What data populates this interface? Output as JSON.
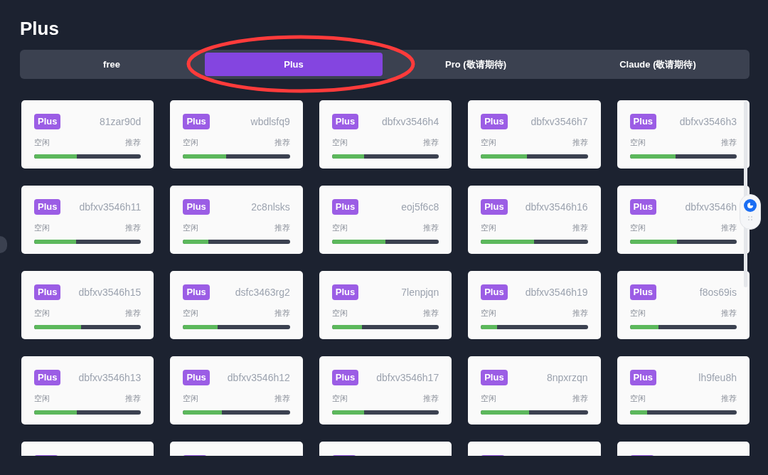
{
  "title": "Plus",
  "tabs": [
    {
      "label": "free",
      "selected": false
    },
    {
      "label": "Plus",
      "selected": true
    },
    {
      "label": "Pro (敬请期待)",
      "selected": false
    },
    {
      "label": "Claude (敬请期待)",
      "selected": false
    }
  ],
  "cards": [
    {
      "badge": "Plus",
      "name": "81zar90d",
      "status": "空闲",
      "tag": "推荐",
      "level": 0.4
    },
    {
      "badge": "Plus",
      "name": "wbdlsfq9",
      "status": "空闲",
      "tag": "推荐",
      "level": 0.4
    },
    {
      "badge": "Plus",
      "name": "dbfxv3546h4",
      "status": "空闲",
      "tag": "推荐",
      "level": 0.3
    },
    {
      "badge": "Plus",
      "name": "dbfxv3546h7",
      "status": "空闲",
      "tag": "推荐",
      "level": 0.43
    },
    {
      "badge": "Plus",
      "name": "dbfxv3546h3",
      "status": "空闲",
      "tag": "推荐",
      "level": 0.43
    },
    {
      "badge": "Plus",
      "name": "dbfxv3546h11",
      "status": "空闲",
      "tag": "推荐",
      "level": 0.39
    },
    {
      "badge": "Plus",
      "name": "2c8nlsks",
      "status": "空闲",
      "tag": "推荐",
      "level": 0.24
    },
    {
      "badge": "Plus",
      "name": "eoj5f6c8",
      "status": "空闲",
      "tag": "推荐",
      "level": 0.5
    },
    {
      "badge": "Plus",
      "name": "dbfxv3546h16",
      "status": "空闲",
      "tag": "推荐",
      "level": 0.5
    },
    {
      "badge": "Plus",
      "name": "dbfxv3546h",
      "status": "空闲",
      "tag": "推荐",
      "level": 0.44
    },
    {
      "badge": "Plus",
      "name": "dbfxv3546h15",
      "status": "空闲",
      "tag": "推荐",
      "level": 0.44
    },
    {
      "badge": "Plus",
      "name": "dsfc3463rg2",
      "status": "空闲",
      "tag": "推荐",
      "level": 0.32
    },
    {
      "badge": "Plus",
      "name": "7lenpjqn",
      "status": "空闲",
      "tag": "推荐",
      "level": 0.28
    },
    {
      "badge": "Plus",
      "name": "dbfxv3546h19",
      "status": "空闲",
      "tag": "推荐",
      "level": 0.15
    },
    {
      "badge": "Plus",
      "name": "f8os69is",
      "status": "空闲",
      "tag": "推荐",
      "level": 0.27
    },
    {
      "badge": "Plus",
      "name": "dbfxv3546h13",
      "status": "空闲",
      "tag": "推荐",
      "level": 0.4
    },
    {
      "badge": "Plus",
      "name": "dbfxv3546h12",
      "status": "空闲",
      "tag": "推荐",
      "level": 0.36
    },
    {
      "badge": "Plus",
      "name": "dbfxv3546h17",
      "status": "空闲",
      "tag": "推荐",
      "level": 0.3
    },
    {
      "badge": "Plus",
      "name": "8npxrzqn",
      "status": "空闲",
      "tag": "推荐",
      "level": 0.45
    },
    {
      "badge": "Plus",
      "name": "lh9feu8h",
      "status": "空闲",
      "tag": "推荐",
      "level": 0.16
    }
  ]
}
